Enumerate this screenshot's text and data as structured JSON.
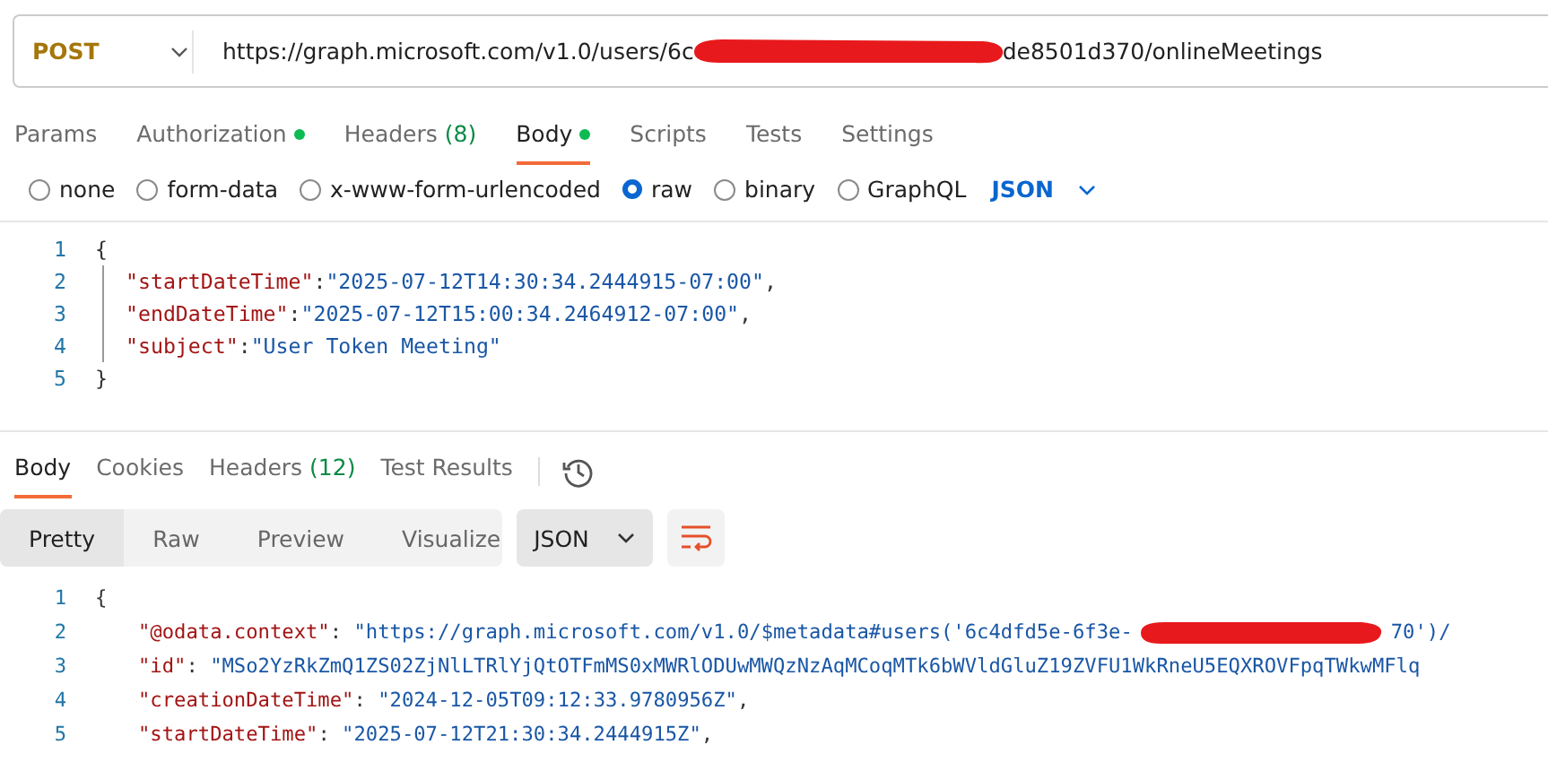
{
  "request": {
    "method": "POST",
    "url_start": "https://graph.microsoft.com/v1.0/users/6c",
    "url_end": "de8501d370/onlineMeetings"
  },
  "request_tabs": [
    {
      "label": "Params",
      "selected": false,
      "dot": false
    },
    {
      "label": "Authorization",
      "selected": false,
      "dot": true
    },
    {
      "label": "Headers",
      "selected": false,
      "dot": false,
      "count": "(8)"
    },
    {
      "label": "Body",
      "selected": true,
      "dot": true
    },
    {
      "label": "Scripts",
      "selected": false,
      "dot": false
    },
    {
      "label": "Tests",
      "selected": false,
      "dot": false
    },
    {
      "label": "Settings",
      "selected": false,
      "dot": false
    }
  ],
  "body_types": [
    {
      "label": "none",
      "selected": false
    },
    {
      "label": "form-data",
      "selected": false
    },
    {
      "label": "x-www-form-urlencoded",
      "selected": false
    },
    {
      "label": "raw",
      "selected": true
    },
    {
      "label": "binary",
      "selected": false
    },
    {
      "label": "GraphQL",
      "selected": false
    }
  ],
  "body_format": "JSON",
  "request_body": [
    {
      "number": "1",
      "tokens": [
        {
          "kind": "punct",
          "text": "{"
        }
      ]
    },
    {
      "number": "2",
      "tokens": [
        {
          "kind": "key",
          "text": "\"startDateTime\""
        },
        {
          "kind": "punct",
          "text": ":"
        },
        {
          "kind": "string",
          "text": "\"2025-07-12T14:30:34.2444915-07:00\""
        },
        {
          "kind": "punct",
          "text": ","
        }
      ]
    },
    {
      "number": "3",
      "tokens": [
        {
          "kind": "key",
          "text": "\"endDateTime\""
        },
        {
          "kind": "punct",
          "text": ":"
        },
        {
          "kind": "string",
          "text": "\"2025-07-12T15:00:34.2464912-07:00\""
        },
        {
          "kind": "punct",
          "text": ","
        }
      ]
    },
    {
      "number": "4",
      "tokens": [
        {
          "kind": "key",
          "text": "\"subject\""
        },
        {
          "kind": "punct",
          "text": ":"
        },
        {
          "kind": "string",
          "text": "\"User Token Meeting\""
        }
      ]
    },
    {
      "number": "5",
      "tokens": [
        {
          "kind": "punct",
          "text": "}"
        }
      ]
    }
  ],
  "response_tabs": [
    {
      "label": "Body",
      "selected": true
    },
    {
      "label": "Cookies",
      "selected": false
    },
    {
      "label": "Headers",
      "selected": false,
      "count": "(12)"
    },
    {
      "label": "Test Results",
      "selected": false
    }
  ],
  "view_modes": [
    {
      "label": "Pretty",
      "selected": true
    },
    {
      "label": "Raw",
      "selected": false
    },
    {
      "label": "Preview",
      "selected": false
    },
    {
      "label": "Visualize",
      "selected": false
    }
  ],
  "response_format": "JSON",
  "response_body": [
    {
      "number": "1",
      "tokens": [
        {
          "kind": "punct",
          "text": "{"
        }
      ]
    },
    {
      "number": "2",
      "tokens": [
        {
          "kind": "key",
          "text": "\"@odata.context\""
        },
        {
          "kind": "punct",
          "text": ": "
        },
        {
          "kind": "string",
          "text": "\"https://graph.microsoft.com/v1.0/$metadata#users('6c4dfd5e-6f3e-"
        },
        {
          "kind": "redaction"
        },
        {
          "kind": "string",
          "text": "70')/"
        }
      ]
    },
    {
      "number": "3",
      "tokens": [
        {
          "kind": "key",
          "text": "\"id\""
        },
        {
          "kind": "punct",
          "text": ": "
        },
        {
          "kind": "string",
          "text": "\"MSo2YzRkZmQ1ZS02ZjNlLTRlYjQtOTFmMS0xMWRlODUwMWQzNzAqMCoqMTk6bWVldGluZ19ZVFU1WkRneU5EQXROVFpqTWkwMFlq"
        }
      ]
    },
    {
      "number": "4",
      "tokens": [
        {
          "kind": "key",
          "text": "\"creationDateTime\""
        },
        {
          "kind": "punct",
          "text": ": "
        },
        {
          "kind": "string",
          "text": "\"2024-12-05T09:12:33.9780956Z\""
        },
        {
          "kind": "punct",
          "text": ","
        }
      ]
    },
    {
      "number": "5",
      "tokens": [
        {
          "kind": "key",
          "text": "\"startDateTime\""
        },
        {
          "kind": "punct",
          "text": ": "
        },
        {
          "kind": "string",
          "text": "\"2025-07-12T21:30:34.2444915Z\""
        },
        {
          "kind": "punct",
          "text": ","
        }
      ]
    }
  ]
}
